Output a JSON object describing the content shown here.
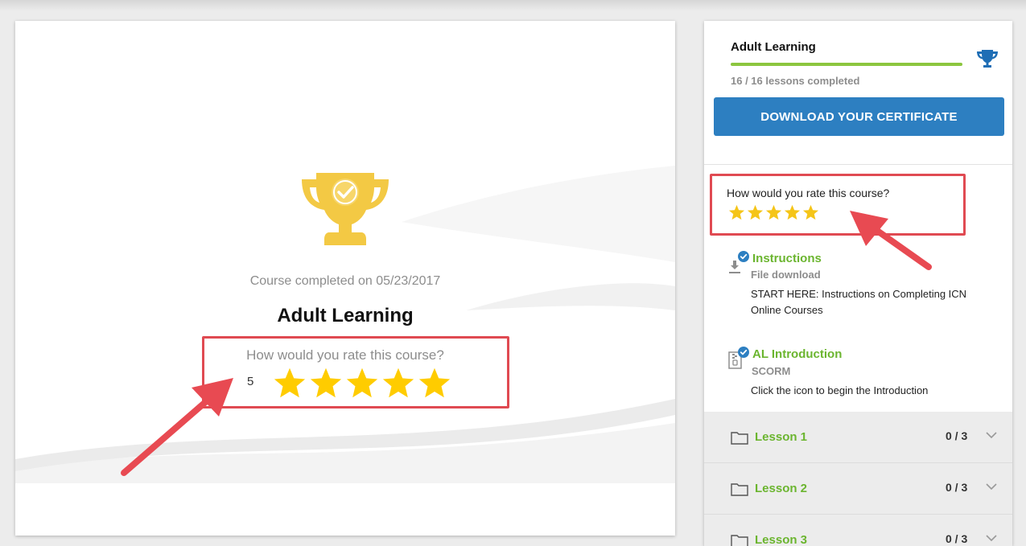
{
  "main": {
    "completed_text": "Course completed on 05/23/2017",
    "course_title": "Adult Learning",
    "rating_question": "How would you rate this course?",
    "rating_value": "5",
    "stars_filled": 5,
    "stars_total": 5,
    "trophy_icon": "trophy-check-icon",
    "accent_star_color": "#ffcc00",
    "trophy_color": "#f3c944"
  },
  "sidebar": {
    "course_title": "Adult Learning",
    "progress_fraction": 1.0,
    "lessons_completed_text": "16 / 16 lessons completed",
    "certificate_button": "DOWNLOAD YOUR CERTIFICATE",
    "rating_question": "How would you rate this course?",
    "stars_filled": 5,
    "items": [
      {
        "title": "Instructions",
        "type": "File download",
        "description": "START HERE: Instructions on Completing ICN Online Courses",
        "icon": "download-icon"
      },
      {
        "title": "AL Introduction",
        "type": "SCORM",
        "description": "Click the icon to begin the Introduction",
        "icon": "scorm-package-icon"
      }
    ],
    "lessons": [
      {
        "label": "Lesson 1",
        "count": "0 / 3"
      },
      {
        "label": "Lesson 2",
        "count": "0 / 3"
      },
      {
        "label": "Lesson 3",
        "count": "0 / 3"
      }
    ],
    "colors": {
      "progress": "#8cc63f",
      "button": "#2d7fc1",
      "link_green": "#6bb52f",
      "trophy_blue": "#1f6eb5",
      "check_blue": "#2d7fc1"
    }
  },
  "annotations": {
    "highlight_color": "#e04a52",
    "arrow_color": "#e84a52"
  }
}
